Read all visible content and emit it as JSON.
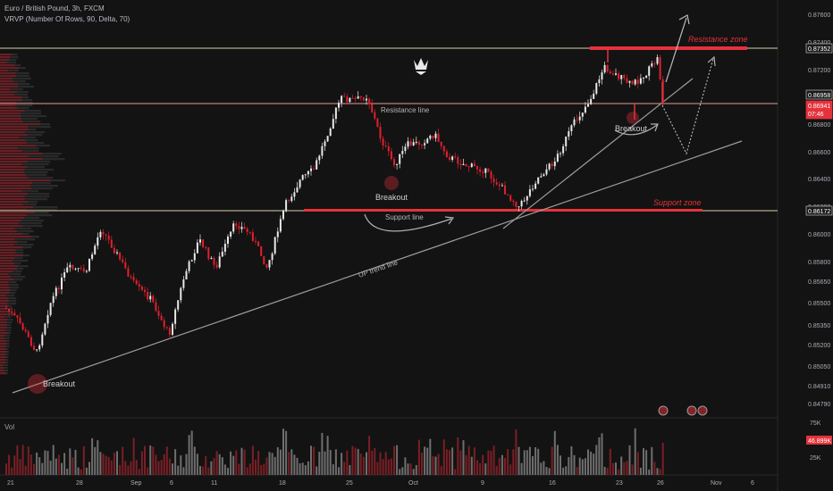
{
  "header": {
    "symbol_line": "Euro / British Pound, 3h, FXCM",
    "indicator_line": "VRVP (Number Of Rows, 90, Delta, 70)"
  },
  "volume_label": "Vol",
  "price_axis": {
    "ticks": [
      "0.87600",
      "0.87400",
      "0.87200",
      "0.87000",
      "0.86800",
      "0.86600",
      "0.86400",
      "0.86200",
      "0.86000",
      "0.85800",
      "0.85650",
      "0.85500",
      "0.85350",
      "0.85200",
      "0.85050",
      "0.84910",
      "0.84790"
    ],
    "badges": [
      {
        "label": "0.87352",
        "style": "outline"
      },
      {
        "label": "0.86958",
        "style": "outline"
      },
      {
        "label": "0.86941",
        "sub": "07:46",
        "style": "red"
      },
      {
        "label": "0.86172",
        "style": "outline"
      }
    ]
  },
  "volume_axis": {
    "ticks": [
      "75K",
      "25K"
    ],
    "badge": "46.899K"
  },
  "time_axis": [
    "21",
    "28",
    "Sep",
    "6",
    "11",
    "18",
    "25",
    "Oct",
    "9",
    "16",
    "23",
    "26",
    "Nov",
    "6"
  ],
  "annotations": {
    "resistance_zone": "Resistance zone",
    "support_zone": "Support zone",
    "resistance_line": "Resistance line",
    "support_line": "Support line",
    "up_trend_line": "UP trend line",
    "breakout_1": "Breakout",
    "breakout_2": "Breakout",
    "breakout_3": "Breakout"
  },
  "colors": {
    "background": "#131313",
    "up_candle": "#e8e8e8",
    "down_candle": "#e0202e",
    "accent_red": "#e4323c",
    "line_gray": "#9c9c9c"
  },
  "icons": [
    "crown-logo-icon",
    "event-icon",
    "event-icon",
    "event-icon"
  ]
}
